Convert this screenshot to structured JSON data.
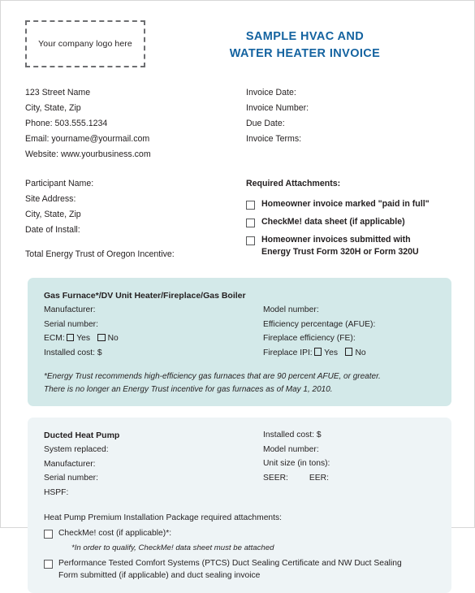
{
  "header": {
    "logo_placeholder": "Your company logo here",
    "title_line1": "SAMPLE HVAC AND",
    "title_line2": "WATER HEATER INVOICE",
    "title_color": "#1463a0"
  },
  "company": {
    "street": "123 Street Name",
    "city_state_zip": "City, State, Zip",
    "phone": "Phone: 503.555.1234",
    "email": "Email: yourname@yourmail.com",
    "website": "Website: www.yourbusiness.com"
  },
  "invoice_fields": [
    "Invoice Date:",
    "Invoice Number:",
    "Due Date:",
    "Invoice Terms:"
  ],
  "participant": {
    "name": "Participant Name:",
    "site_address": "Site Address:",
    "city_state_zip": "City, State, Zip",
    "date_of_install": "Date of Install:",
    "total_incentive": "Total Energy Trust of Oregon Incentive:"
  },
  "required_attachments": {
    "heading": "Required Attachments:",
    "items": [
      "Homeowner invoice marked \"paid in full\"",
      "CheckMe! data sheet (if applicable)",
      "Homeowner invoices submitted with"
    ],
    "item3_line2": "Energy Trust Form 320H or Form 320U"
  },
  "gas_furnace": {
    "bg_color": "#d3e9e9",
    "heading": "Gas Furnace*/DV Unit Heater/Fireplace/Gas Boiler",
    "left": {
      "manufacturer": "Manufacturer:",
      "serial_number": "Serial number:",
      "ecm_label": "ECM:",
      "ecm_yes": "Yes",
      "ecm_no": "No",
      "installed_cost": "Installed cost: $"
    },
    "right": {
      "model_number": "Model number:",
      "efficiency": "Efficiency percentage (AFUE):",
      "fireplace_efficiency": "Fireplace efficiency (FE):",
      "fireplace_ipi_label": "Fireplace IPI:",
      "fireplace_ipi_yes": "Yes",
      "fireplace_ipi_no": "No"
    },
    "note_line1": "*Energy Trust recommends high-efficiency gas furnaces that are 90 percent AFUE, or greater.",
    "note_line2": "There is no longer an Energy Trust incentive for gas furnaces as of May 1, 2010."
  },
  "heat_pump": {
    "bg_color": "#eef4f6",
    "heading": "Ducted Heat Pump",
    "left": {
      "system_replaced": "System replaced:",
      "manufacturer": "Manufacturer:",
      "serial_number": "Serial number:",
      "hspf": "HSPF:"
    },
    "right": {
      "installed_cost": "Installed cost: $",
      "model_number": "Model number:",
      "unit_size": "Unit size (in tons):",
      "seer": "SEER:",
      "eer": "EER:"
    },
    "premium_heading": "Heat Pump Premium Installation Package required attachments:",
    "checkme_item": "CheckMe! cost (if applicable)*:",
    "checkme_note": "*In order to qualify, CheckMe! data sheet must be attached",
    "ptcs_line1": "Performance Tested Comfort Systems (PTCS) Duct Sealing Certificate and NW Duct Sealing",
    "ptcs_line2": "Form submitted (if applicable) and duct sealing invoice"
  }
}
